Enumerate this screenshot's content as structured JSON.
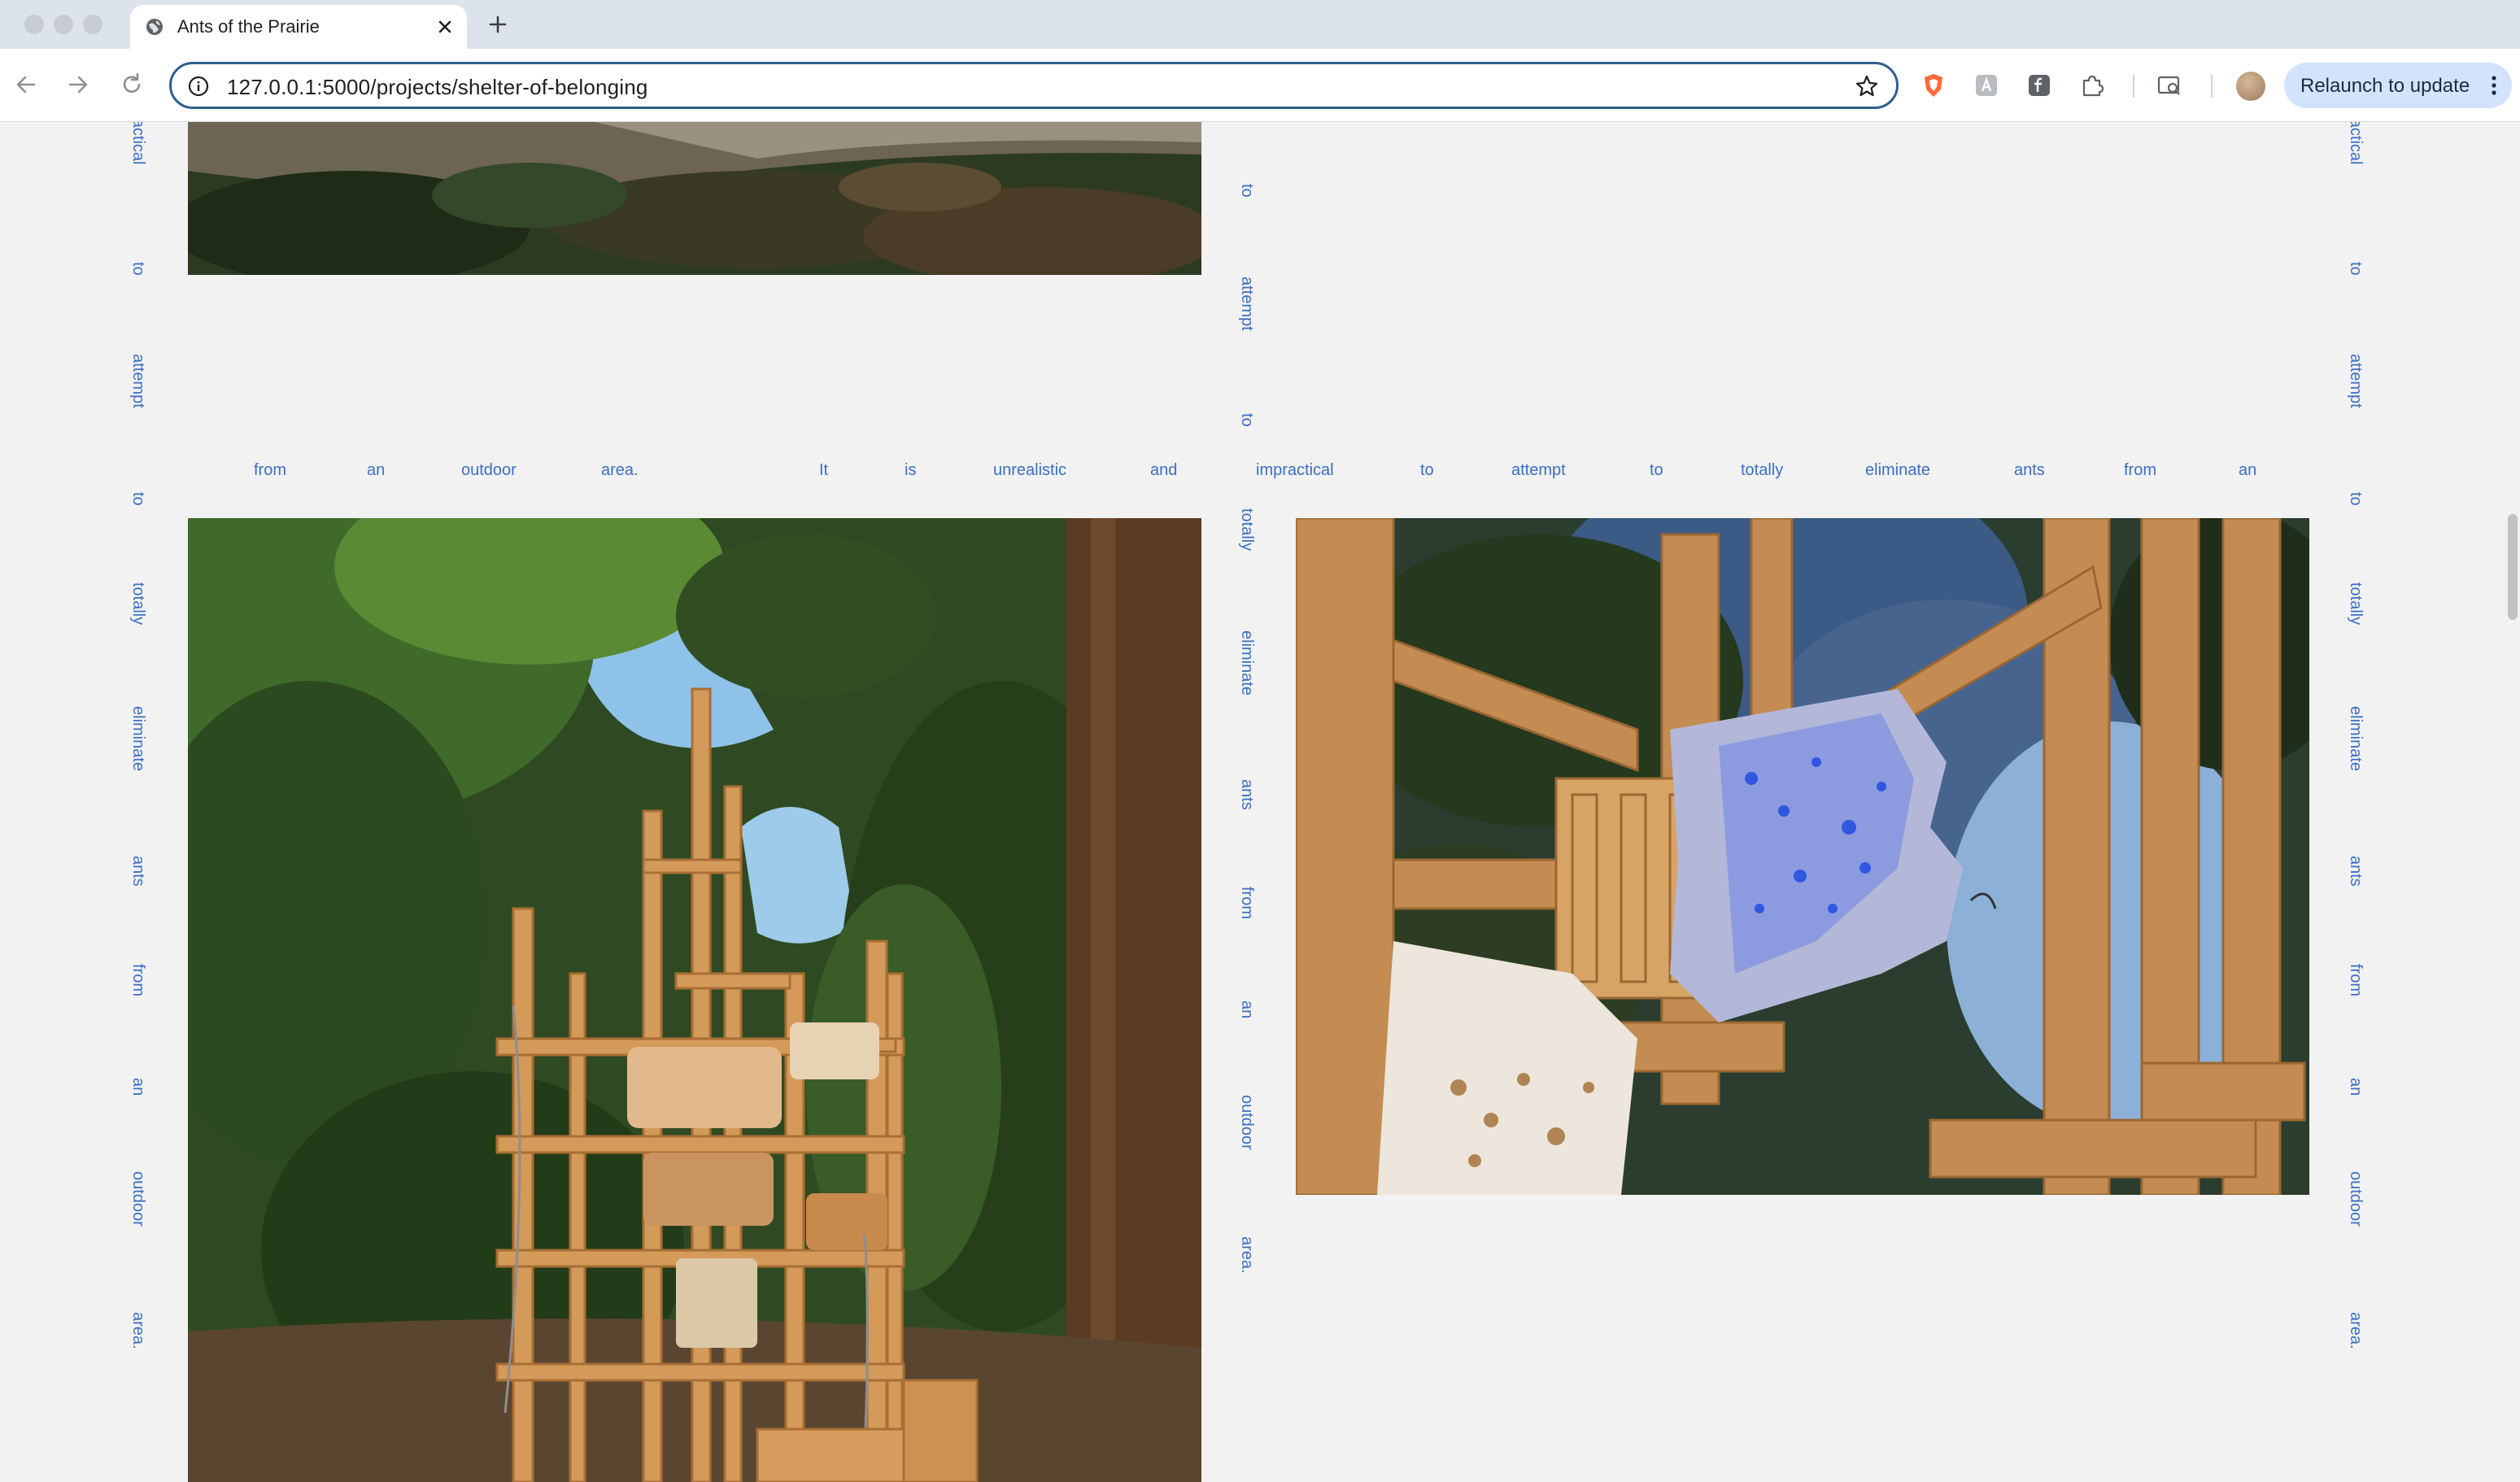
{
  "browser": {
    "tab_title": "Ants of the Prairie",
    "url": "127.0.0.1:5000/projects/shelter-of-belonging",
    "relaunch_label": "Relaunch to update"
  },
  "page": {
    "middle_column_words": [
      "to",
      "attempt",
      "to",
      "totally",
      "eliminate",
      "ants",
      "from",
      "an",
      "outdoor",
      "area."
    ],
    "left_column_words": [
      "practical",
      "to",
      "attempt",
      "to",
      "totally",
      "eliminate",
      "ants",
      "from",
      "an",
      "outdoor",
      "area."
    ],
    "right_column_words": [
      "practical",
      "to",
      "attempt",
      "to",
      "totally",
      "eliminate",
      "ants",
      "from",
      "an",
      "outdoor",
      "area."
    ],
    "horizontal_words": [
      "from",
      "an",
      "outdoor",
      "area.",
      "It",
      "is",
      "unrealistic",
      "and",
      "impractical",
      "to",
      "attempt",
      "to",
      "totally",
      "eliminate",
      "ants",
      "from",
      "an"
    ]
  }
}
